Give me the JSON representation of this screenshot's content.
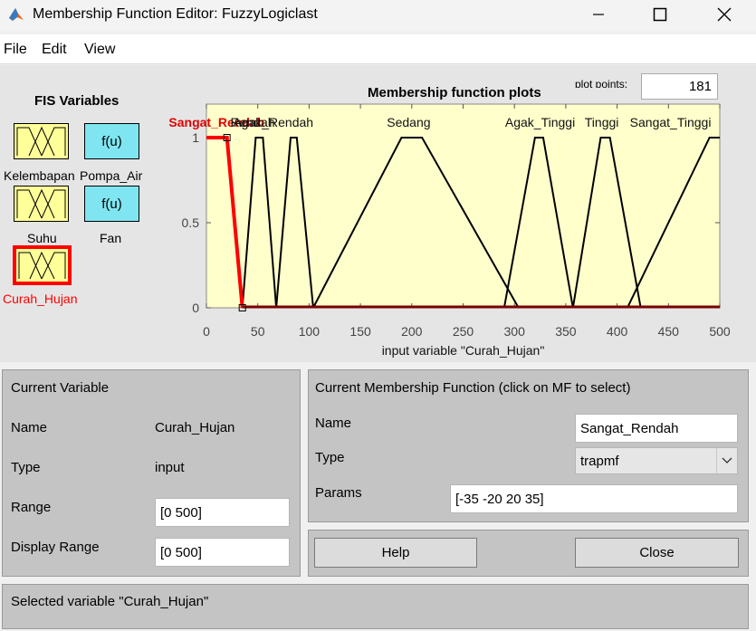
{
  "window": {
    "title": "Membership Function Editor: FuzzyLogiclast",
    "icon": "matlab-logo-icon",
    "controls": [
      "minimize-icon",
      "maximize-icon",
      "close-icon"
    ]
  },
  "menu": {
    "file": "File",
    "edit": "Edit",
    "view": "View"
  },
  "fis": {
    "title": "FIS Variables",
    "inputs": [
      "Kelembapan",
      "Suhu",
      "Curah_Hujan"
    ],
    "outputs": [
      "Pompa_Air",
      "Fan"
    ],
    "output_symbol": "f(u)",
    "selected": "Curah_Hujan",
    "selected_color": "#ff0000",
    "input_color": "#ffff99",
    "output_color": "#7fe5f0"
  },
  "plot": {
    "title": "Membership function plots",
    "plot_points_label": "plot points:",
    "plot_points_value": "181",
    "xlabel": "input variable \"Curah_Hujan\"",
    "background": "#ffffcc"
  },
  "chart_data": {
    "type": "line",
    "title": "Membership function plots",
    "xlabel": "input variable \"Curah_Hujan\"",
    "ylabel": "",
    "xlim": [
      0,
      500
    ],
    "ylim": [
      0,
      1
    ],
    "xticks": [
      0,
      50,
      100,
      150,
      200,
      250,
      300,
      350,
      400,
      450,
      500
    ],
    "yticks": [
      0,
      0.5,
      1
    ],
    "xtick_labels": [
      "0",
      "50",
      "100",
      "150",
      "200",
      "250",
      "300",
      "350",
      "400",
      "450",
      "500"
    ],
    "ytick_labels": [
      "0",
      "0.5",
      "1"
    ],
    "selected_series": "Sangat_Rendah",
    "series": [
      {
        "name": "Sangat_Rendah",
        "type": "trapmf",
        "points": [
          [
            -35,
            0
          ],
          [
            -20,
            1
          ],
          [
            20,
            1
          ],
          [
            35,
            0
          ]
        ],
        "selected": true,
        "color": "#ff0000"
      },
      {
        "name": "Rendah",
        "type": "trapmf",
        "points": [
          [
            35,
            0
          ],
          [
            48,
            1
          ],
          [
            55,
            1
          ],
          [
            68,
            0
          ]
        ],
        "color": "#000000"
      },
      {
        "name": "Agak_Rendah",
        "type": "trapmf",
        "points": [
          [
            68,
            0
          ],
          [
            82,
            1
          ],
          [
            88,
            1
          ],
          [
            104,
            0
          ]
        ],
        "color": "#000000"
      },
      {
        "name": "Sedang",
        "type": "trapmf",
        "points": [
          [
            104,
            0
          ],
          [
            190,
            1
          ],
          [
            210,
            1
          ],
          [
            304,
            0
          ]
        ],
        "color": "#000000"
      },
      {
        "name": "Agak_Tinggi",
        "type": "trapmf",
        "points": [
          [
            290,
            0
          ],
          [
            320,
            1
          ],
          [
            328,
            1
          ],
          [
            357,
            0
          ]
        ],
        "color": "#000000"
      },
      {
        "name": "Tinggi",
        "type": "trapmf",
        "points": [
          [
            357,
            0
          ],
          [
            384,
            1
          ],
          [
            393,
            1
          ],
          [
            423,
            0
          ]
        ],
        "color": "#000000"
      },
      {
        "name": "Sangat_Tinggi",
        "type": "trapmf",
        "points": [
          [
            410,
            0
          ],
          [
            490,
            1
          ],
          [
            500,
            1
          ]
        ],
        "color": "#000000"
      }
    ],
    "labels": [
      {
        "text": "Sangat_Rendah",
        "x": 10,
        "selected": true
      },
      {
        "text": "Rendah",
        "x": 45
      },
      {
        "text": "Agak_Rendah",
        "x": 65
      },
      {
        "text": "Sedang",
        "x": 197
      },
      {
        "text": "Agak_Tinggi",
        "x": 325
      },
      {
        "text": "Tinggi",
        "x": 385
      },
      {
        "text": "Sangat_Tinggi",
        "x": 452
      }
    ]
  },
  "current_variable": {
    "title": "Current Variable",
    "name_label": "Name",
    "name_value": "Curah_Hujan",
    "type_label": "Type",
    "type_value": "input",
    "range_label": "Range",
    "range_value": "[0 500]",
    "display_range_label": "Display Range",
    "display_range_value": "[0 500]"
  },
  "current_mf": {
    "title": "Current Membership Function (click on MF to select)",
    "name_label": "Name",
    "name_value": "Sangat_Rendah",
    "type_label": "Type",
    "type_value": "trapmf",
    "params_label": "Params",
    "params_value": "[-35 -20 20 35]"
  },
  "buttons": {
    "help": "Help",
    "close": "Close"
  },
  "status": "Selected variable \"Curah_Hujan\""
}
